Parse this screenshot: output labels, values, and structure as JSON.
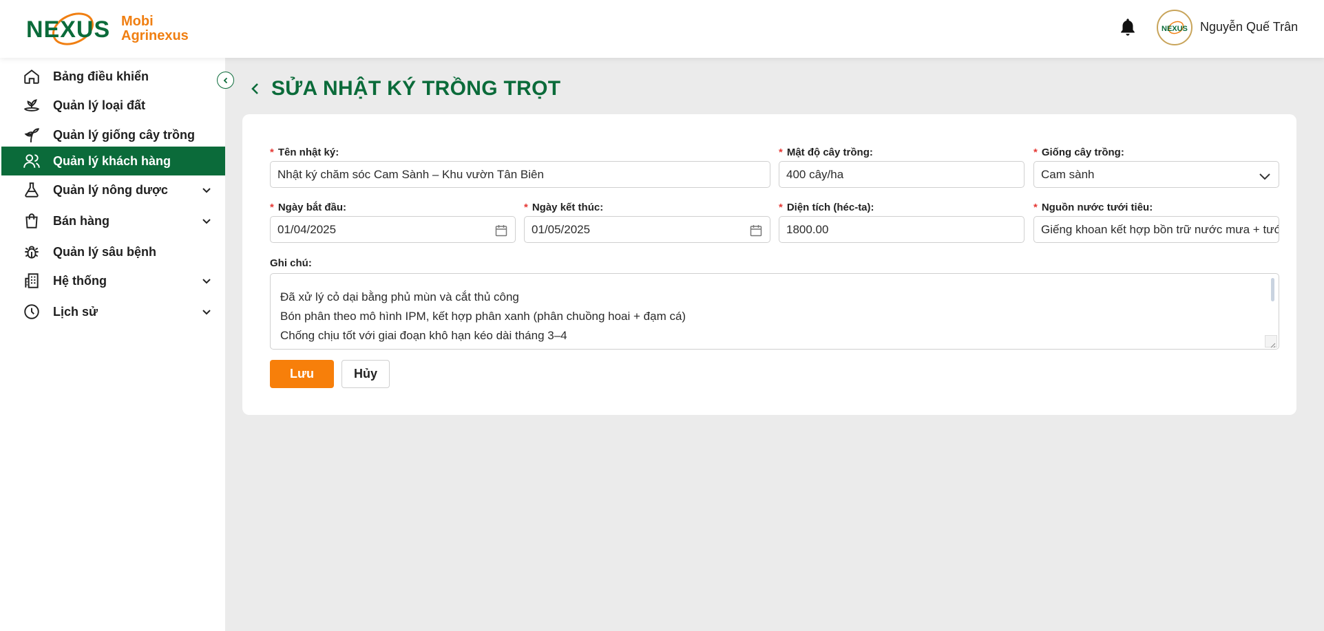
{
  "brand": {
    "logo_word": "NEXUS",
    "name_line1": "Mobi",
    "name_line2": "Agrinexus",
    "green": "#0b6b3a",
    "orange": "#f07f12"
  },
  "header": {
    "user_name": "Nguyễn Quế Trân",
    "avatar_text": "NEXUS"
  },
  "sidebar": {
    "items": [
      {
        "label": "Bảng điều khiển",
        "icon": "home-icon"
      },
      {
        "label": "Quản lý loại đất",
        "icon": "soil-icon"
      },
      {
        "label": "Quản lý giống cây trồng",
        "icon": "plant-icon"
      },
      {
        "label": "Quản lý khách hàng",
        "icon": "users-icon",
        "active": true
      },
      {
        "label": "Quản lý nông dược",
        "icon": "flask-icon",
        "expandable": true
      },
      {
        "label": "Bán hàng",
        "icon": "shopping-bag-icon",
        "expandable": true
      },
      {
        "label": "Quản lý sâu bệnh",
        "icon": "bug-icon"
      },
      {
        "label": "Hệ thống",
        "icon": "building-icon",
        "expandable": true
      },
      {
        "label": "Lịch sử",
        "icon": "clock-icon",
        "expandable": true
      }
    ]
  },
  "page": {
    "title": "SỬA NHẬT KÝ TRỒNG TRỌT"
  },
  "form": {
    "required_mark": "*",
    "log_name": {
      "label": "Tên nhật ký:",
      "value": "Nhật ký chăm sóc Cam Sành – Khu vườn Tân Biên"
    },
    "density": {
      "label": "Mật độ cây trồng:",
      "value": "400 cây/ha"
    },
    "variety": {
      "label": "Giống cây trồng:",
      "value": "Cam sành"
    },
    "start_date": {
      "label": "Ngày bắt đầu:",
      "value": "01/04/2025"
    },
    "end_date": {
      "label": "Ngày kết thúc:",
      "value": "01/05/2025"
    },
    "area": {
      "label": "Diện tích (héc-ta):",
      "value": "1800.00"
    },
    "water_source": {
      "label": "Nguồn nước tưới tiêu:",
      "value": "Giếng khoan kết hợp bồn trữ nước mưa + tưới nhỏ giọt"
    },
    "notes": {
      "label": "Ghi chú:",
      "lines": [
        "Đã xử lý cỏ dại bằng phủ mùn và cắt thủ công",
        "Bón phân theo mô hình IPM, kết hợp phân xanh (phân chuồng hoai + đạm cá)",
        "Chống chịu tốt với giai đoạn khô hạn kéo dài tháng 3–4"
      ]
    },
    "save_label": "Lưu",
    "cancel_label": "Hủy"
  }
}
